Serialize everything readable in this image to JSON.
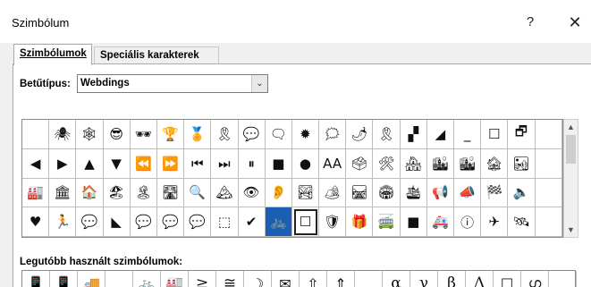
{
  "window": {
    "title": "Szimbólum",
    "help_label": "?",
    "close_label": "✕"
  },
  "tabs": [
    {
      "label": "Szimbólumok",
      "active": true
    },
    {
      "label": "Speciális karakterek",
      "active": false
    }
  ],
  "font": {
    "label": "Betűtípus:",
    "value": "Webdings"
  },
  "symbol_grid": {
    "selected_index": 69,
    "rows": [
      [
        " ",
        "🕷",
        "🕸",
        "😎",
        "🕶",
        "🏆",
        "🏅",
        "🎗",
        "💬",
        "🗨",
        "✹",
        "🗯",
        "🌶",
        "🎗",
        "▞",
        "◢",
        "_",
        "☐",
        "🗗",
        ""
      ],
      [
        "◀",
        "▶",
        "▲",
        "▼",
        "⏪",
        "⏩",
        "⏮",
        "⏭",
        "⏸",
        "■",
        "●",
        "AA",
        "🗳",
        "🛠",
        "🏘",
        "🏙",
        "🏙",
        "🏚",
        "🏜",
        ""
      ],
      [
        "🏭",
        "🏛",
        "🏠",
        "🏖",
        "🏝",
        "🛣",
        "🔍",
        "🏔",
        "👁",
        "👂",
        "🏞",
        "🏕",
        "🛤",
        "🏟",
        "🛳",
        "📢",
        "📣",
        "🏁",
        "🔈",
        ""
      ],
      [
        "♥",
        "🏃",
        "💬",
        "◣",
        "💬",
        "💬",
        "💬",
        "⬚",
        "✔",
        "🚲",
        "☐",
        "🛡",
        "🎁",
        "🚎",
        "■",
        "🚑",
        "ⓘ",
        "✈",
        "🛰",
        ""
      ]
    ]
  },
  "scrollbar": {
    "up_icon": "▲",
    "down_icon": "▼"
  },
  "recent": {
    "label": "Legutóbb használt szimbólumok:",
    "items": [
      "📱",
      "📱",
      "🚚",
      "",
      "🚲",
      "🏭",
      "≥",
      "≅",
      "☽",
      "✉",
      "⇧",
      "⇑",
      "",
      "α",
      "γ",
      "β",
      "Δ",
      "☐",
      "ഗ",
      ""
    ]
  }
}
